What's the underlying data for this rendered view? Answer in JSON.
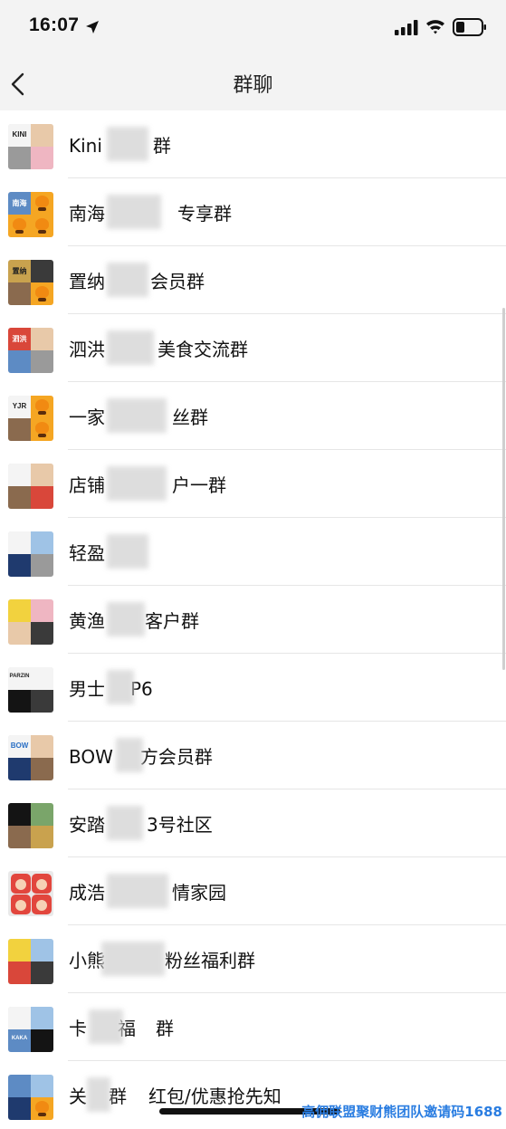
{
  "status_bar": {
    "time": "16:07"
  },
  "nav": {
    "title": "群聊"
  },
  "groups": [
    {
      "name": "Kini",
      "name_tail": "群",
      "badge": "KINI"
    },
    {
      "name": "南海",
      "name_tail": "专享群",
      "badge": "南海"
    },
    {
      "name": "置纳",
      "name_tail": "会员群",
      "badge": "置纳"
    },
    {
      "name": "泗洪",
      "name_tail": "美食交流群",
      "badge": "泗洪"
    },
    {
      "name": "一家",
      "name_tail": "丝群",
      "badge": "YJR"
    },
    {
      "name": "店铺",
      "name_tail": "户一群",
      "badge": ""
    },
    {
      "name": "轻盈",
      "name_tail": "",
      "badge": ""
    },
    {
      "name": "黄渔",
      "name_tail": "客户群",
      "badge": ""
    },
    {
      "name": "男士",
      "name_tail": "P6",
      "badge": "PARZIN"
    },
    {
      "name": "BOW",
      "name_tail": "方会员群",
      "badge": "BOW"
    },
    {
      "name": "安踏",
      "name_tail": "3号社区",
      "badge": ""
    },
    {
      "name": "成浩",
      "name_tail": "情家园",
      "badge": ""
    },
    {
      "name": "小熊",
      "name_tail": "粉丝福利群",
      "badge": ""
    },
    {
      "name": "卡",
      "name_tail": "福",
      "name_tail2": "群",
      "badge": "KAKA"
    },
    {
      "name": "关",
      "name_tail": "群",
      "name_tail2": "红包/优惠抢先知",
      "badge": ""
    }
  ],
  "watermark": "高佣联盟聚财熊团队邀请码1688",
  "icons": {
    "location": "location-arrow-icon",
    "signal": "signal-icon",
    "wifi": "wifi-icon",
    "battery": "battery-icon",
    "back": "back-chevron-icon"
  },
  "colors": {
    "header_bg": "#f3f3f3",
    "divider": "#e6e6e6",
    "watermark": "#2a7de1"
  }
}
